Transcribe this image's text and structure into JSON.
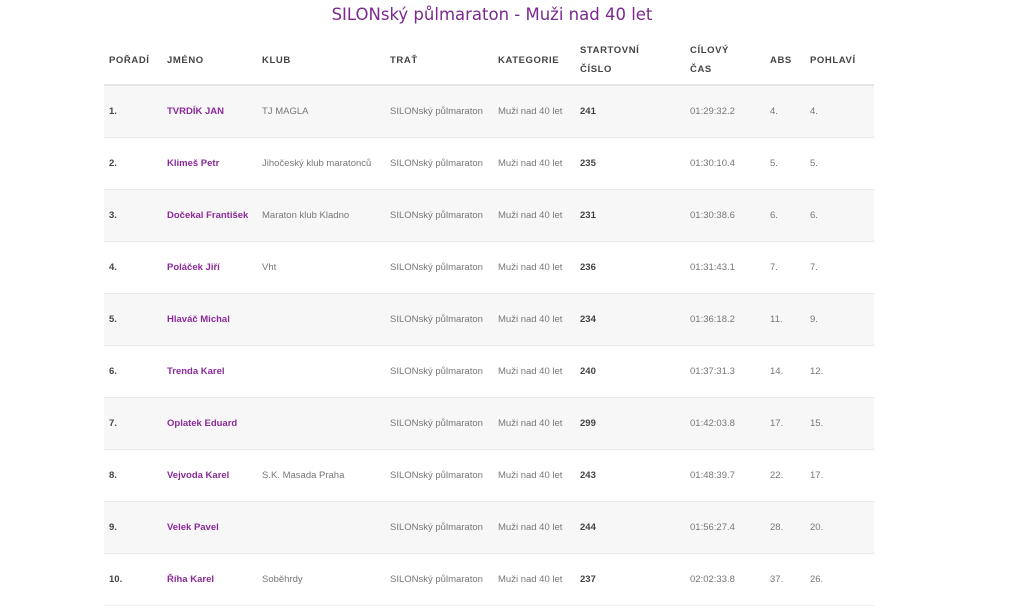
{
  "title": "SILONský půlmaraton - Muži nad 40 let",
  "columns": {
    "position": "POŘADÍ",
    "name": "JMÉNO",
    "club": "KLUB",
    "track": "TRAŤ",
    "category": "KATEGORIE",
    "bib_line1": "STARTOVNÍ",
    "bib_line2": "ČÍSLO",
    "time_line1": "CÍLOVÝ",
    "time_line2": "ČAS",
    "abs": "ABS",
    "gender": "POHLAVÍ"
  },
  "rows": [
    {
      "position": "1.",
      "name": "TVRDÍK JAN",
      "club": "TJ MAGLA",
      "track": "SILONský půlmaraton",
      "category": "Muži nad 40 let",
      "bib": "241",
      "time": "01:29:32.2",
      "abs": "4.",
      "gender": "4."
    },
    {
      "position": "2.",
      "name": "Klimeš Petr",
      "club": "Jihočeský klub maratonců",
      "track": "SILONský půlmaraton",
      "category": "Muži nad 40 let",
      "bib": "235",
      "time": "01:30:10.4",
      "abs": "5.",
      "gender": "5."
    },
    {
      "position": "3.",
      "name": "Dočekal František",
      "club": "Maraton klub Kladno",
      "track": "SILONský půlmaraton",
      "category": "Muži nad 40 let",
      "bib": "231",
      "time": "01:30:38.6",
      "abs": "6.",
      "gender": "6."
    },
    {
      "position": "4.",
      "name": "Poláček Jiří",
      "club": "Vht",
      "track": "SILONský půlmaraton",
      "category": "Muži nad 40 let",
      "bib": "236",
      "time": "01:31:43.1",
      "abs": "7.",
      "gender": "7."
    },
    {
      "position": "5.",
      "name": "Hlaváč Michal",
      "club": "",
      "track": "SILONský půlmaraton",
      "category": "Muži nad 40 let",
      "bib": "234",
      "time": "01:36:18.2",
      "abs": "11.",
      "gender": "9."
    },
    {
      "position": "6.",
      "name": "Trenda Karel",
      "club": "",
      "track": "SILONský půlmaraton",
      "category": "Muži nad 40 let",
      "bib": "240",
      "time": "01:37:31.3",
      "abs": "14.",
      "gender": "12."
    },
    {
      "position": "7.",
      "name": "Oplatek Eduard",
      "club": "",
      "track": "SILONský půlmaraton",
      "category": "Muži nad 40 let",
      "bib": "299",
      "time": "01:42:03.8",
      "abs": "17.",
      "gender": "15."
    },
    {
      "position": "8.",
      "name": "Vejvoda Karel",
      "club": "S.K. Masada Praha",
      "track": "SILONský půlmaraton",
      "category": "Muži nad 40 let",
      "bib": "243",
      "time": "01:48:39.7",
      "abs": "22.",
      "gender": "17."
    },
    {
      "position": "9.",
      "name": "Velek Pavel",
      "club": "",
      "track": "SILONský půlmaraton",
      "category": "Muži nad 40 let",
      "bib": "244",
      "time": "01:56:27.4",
      "abs": "28.",
      "gender": "20."
    },
    {
      "position": "10.",
      "name": "Říha Karel",
      "club": "Soběhrdy",
      "track": "SILONský půlmaraton",
      "category": "Muži nad 40 let",
      "bib": "237",
      "time": "02:02:33.8",
      "abs": "37.",
      "gender": "26."
    }
  ]
}
